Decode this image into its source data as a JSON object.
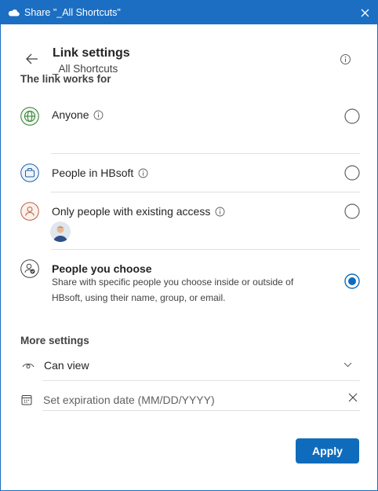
{
  "window": {
    "title": "Share \"_All Shortcuts\""
  },
  "header": {
    "title": "Link settings",
    "subtitle": "_All Shortcuts"
  },
  "link_works_for": {
    "label": "The link works for",
    "options": [
      {
        "label": "Anyone",
        "selected": false
      },
      {
        "label": "People in HBsoft",
        "selected": false
      },
      {
        "label": "Only people with existing access",
        "selected": false
      },
      {
        "label": "People you choose",
        "description": "Share with specific people you choose inside or outside of HBsoft, using their name, group, or email.",
        "selected": true
      }
    ]
  },
  "more_settings": {
    "label": "More settings",
    "permission": "Can view",
    "expiration_placeholder": "Set expiration date (MM/DD/YYYY)"
  },
  "actions": {
    "apply": "Apply"
  },
  "colors": {
    "accent": "#0f6cbd",
    "titlebar": "#1b6ec2",
    "anyone_icon": "#2e7d32",
    "org_icon": "#1f5fa8",
    "existing_icon": "#b8623d"
  }
}
